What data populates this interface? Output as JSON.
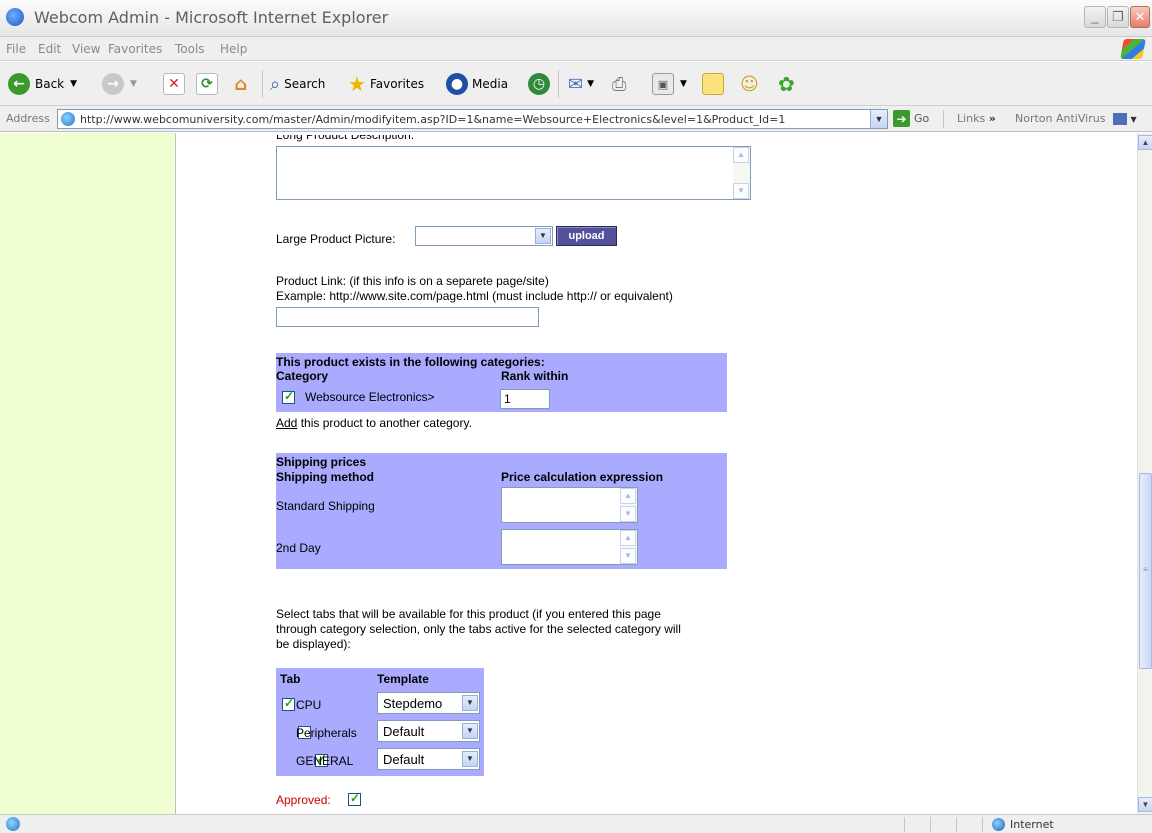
{
  "window": {
    "title": "Webcom Admin - Microsoft Internet Explorer"
  },
  "menu": [
    "File",
    "Edit",
    "View",
    "Favorites",
    "Tools",
    "Help"
  ],
  "toolbar": {
    "back_label": "Back",
    "search_label": "Search",
    "favorites_label": "Favorites",
    "media_label": "Media"
  },
  "address": {
    "label": "Address",
    "url": "http://www.webcomuniversity.com/master/Admin/modifyitem.asp?ID=1&name=Websource+Electronics&level=1&Product_Id=1",
    "go_label": "Go",
    "links_label": "Links",
    "links_chevron": "»",
    "norton_label": "Norton AntiVirus"
  },
  "form": {
    "long_desc_label": "Long Product Description:",
    "large_picture_label": "Large Product Picture:",
    "large_picture_value": "",
    "upload_label": "upload",
    "product_link_label": "Product Link: (if this info is on a separete page/site)",
    "product_link_example": "Example: http://www.site.com/page.html (must include http:// or equivalent)",
    "product_link_value": "",
    "categories": {
      "heading": "This product exists in the following categories:",
      "col_category": "Category",
      "col_rank": "Rank within",
      "rows": [
        {
          "name": "Websource Electronics>",
          "rank": "1",
          "checked": true
        }
      ]
    },
    "add_link": "Add",
    "add_rest": " this product to another category.",
    "shipping": {
      "heading": "Shipping prices",
      "col_method": "Shipping method",
      "col_expr": "Price calculation expression",
      "rows": [
        {
          "method": "Standard Shipping",
          "expr": ""
        },
        {
          "method": "2nd Day",
          "expr": ""
        }
      ]
    },
    "tabs_intro_1": "Select tabs that will be available for this product (if you entered this page",
    "tabs_intro_2": "through category selection, only the tabs active for the selected category will",
    "tabs_intro_3": "be displayed):",
    "tabs": {
      "col_tab": "Tab",
      "col_template": "Template",
      "rows": [
        {
          "tab": "CPU",
          "template": "Stepdemo",
          "checked": true
        },
        {
          "tab": "Peripherals",
          "template": "Default",
          "checked": false
        },
        {
          "tab": "GENERAL",
          "template": "Default",
          "checked": true
        }
      ]
    },
    "approved_label": "Approved:",
    "approved_checked": true
  },
  "status": {
    "zone": "Internet"
  },
  "colors": {
    "sidebar": "#f0ffd2",
    "panel": "#aaaaff",
    "upload_button": "#52519a",
    "approved_text": "#d00000"
  }
}
